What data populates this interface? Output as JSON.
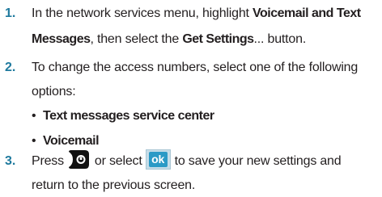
{
  "steps": [
    {
      "number": "1.",
      "line1_pre": "In the network services menu, highlight ",
      "line1_bold": "Voicemail and Text",
      "line2_bold1": "Messages",
      "line2_mid": ", then select the ",
      "line2_bold2": "Get Settings",
      "line2_post": "... button."
    },
    {
      "number": "2.",
      "line1": "To change the access numbers, select one of the following",
      "line2": "options:",
      "bullets": [
        "Text messages service center",
        "Voicemail"
      ]
    },
    {
      "number": "3.",
      "pre": "Press",
      "mid": "or select",
      "post": "to save your new settings and",
      "line2": "return to the previous screen.",
      "ok_label": "ok",
      "key_icon": "end-key-icon"
    }
  ],
  "colors": {
    "step_number": "#1f7a9e",
    "ok_button": "#2b9ac6"
  }
}
